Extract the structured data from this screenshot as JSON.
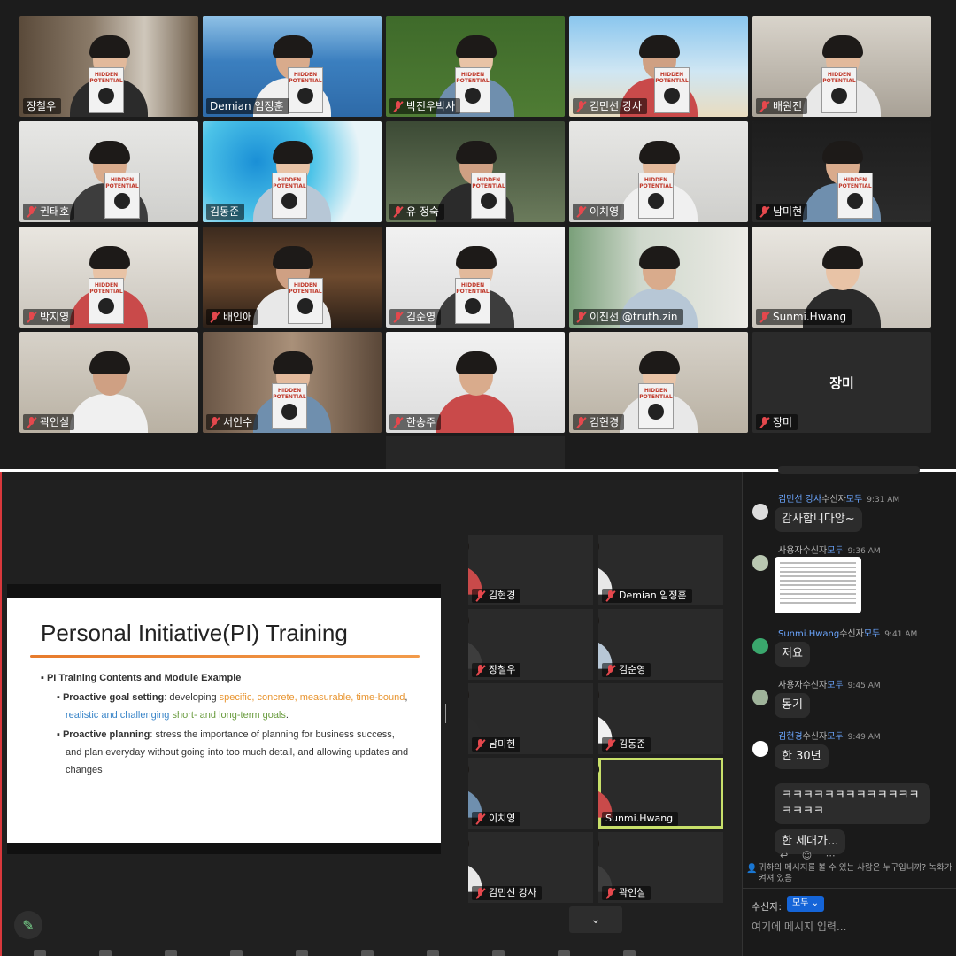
{
  "gallery": [
    {
      "name": "장철우",
      "muted": false,
      "bg": "library",
      "book": true
    },
    {
      "name": "Demian 임정훈",
      "muted": false,
      "bg": "ocean",
      "book": true,
      "active": true
    },
    {
      "name": "박진우박사",
      "muted": true,
      "bg": "green",
      "book": true
    },
    {
      "name": "김민선 강사",
      "muted": true,
      "bg": "beach",
      "book": true
    },
    {
      "name": "배원진",
      "muted": true,
      "bg": "hall",
      "book": true
    },
    {
      "name": "권태호",
      "muted": true,
      "bg": "office",
      "book": true
    },
    {
      "name": "김동준",
      "muted": false,
      "bg": "watercolor",
      "book": true
    },
    {
      "name": "유 정숙",
      "muted": true,
      "bg": "forest",
      "book": true
    },
    {
      "name": "이치영",
      "muted": true,
      "bg": "office",
      "book": true
    },
    {
      "name": "남미현",
      "muted": true,
      "bg": "dark",
      "book": true
    },
    {
      "name": "박지영",
      "muted": true,
      "bg": "room",
      "book": true
    },
    {
      "name": "배인애",
      "muted": true,
      "bg": "library2",
      "book": true
    },
    {
      "name": "김순영",
      "muted": true,
      "bg": "white",
      "book": true
    },
    {
      "name": "이진선 @truth.zin",
      "muted": true,
      "bg": "plant",
      "book": false
    },
    {
      "name": "Sunmi.Hwang",
      "muted": true,
      "bg": "room",
      "book": false
    },
    {
      "name": "곽인실",
      "muted": true,
      "bg": "blur",
      "book": false
    },
    {
      "name": "서인수",
      "muted": true,
      "bg": "shelf",
      "book": true
    },
    {
      "name": "한송주",
      "muted": true,
      "bg": "white",
      "book": false
    },
    {
      "name": "김현경",
      "muted": true,
      "bg": "blur",
      "book": true
    },
    {
      "name": "장미",
      "muted": true,
      "bg": "none",
      "book": false,
      "avatar_text": "장미"
    }
  ],
  "book_title": "HIDDEN POTENTIAL",
  "slide": {
    "title": "Personal Initiative(PI) Training",
    "heading": "PI Training Contents and Module Example",
    "item1_label": "Proactive goal setting",
    "item1_text": ": developing ",
    "item1_orange": "specific, concrete, measurable, time-bound",
    "item1_comma": ", ",
    "item1_blue": "realistic and challenging",
    "item1_space": " ",
    "item1_green": "short- and long-term goals",
    "item1_end": ".",
    "item2_label": "Proactive planning",
    "item2_text": ": stress the importance of planning for business success, and plan everyday without going into too much detail, and allowing updates and changes"
  },
  "side_tiles": [
    {
      "name": "김현경",
      "bg": "blur"
    },
    {
      "name": "Demian 임정훈",
      "bg": "ocean"
    },
    {
      "name": "장철우",
      "bg": "library"
    },
    {
      "name": "김순영",
      "bg": "white"
    },
    {
      "name": "남미현",
      "bg": "dark"
    },
    {
      "name": "김동준",
      "bg": "watercolor"
    },
    {
      "name": "이치영",
      "bg": "office"
    },
    {
      "name": "Sunmi.Hwang",
      "bg": "room",
      "active": true
    },
    {
      "name": "김민선 강사",
      "bg": "beach"
    },
    {
      "name": "곽인실",
      "bg": "blur"
    }
  ],
  "chat": {
    "recipient_word": "수신자",
    "everyone": "모두",
    "messages": [
      {
        "sender": "김민선 강사",
        "time": "9:31 AM",
        "text": "감사합니다앙~"
      },
      {
        "sender": "사용자",
        "time": "9:36 AM",
        "image": true
      },
      {
        "sender": "Sunmi.Hwang",
        "time": "9:41 AM",
        "text": "저요"
      },
      {
        "sender": "사용자",
        "time": "9:45 AM",
        "text": "동기"
      },
      {
        "sender": "김현경",
        "time": "9:49 AM",
        "text": "한 30년"
      },
      {
        "text": "ㅋㅋㅋㅋㅋㅋㅋㅋㅋㅋㅋㅋㅋㅋㅋㅋㅋ"
      },
      {
        "text": "한 세대가..."
      }
    ],
    "actions": "↩ ☺ ⋯",
    "privacy_note": "귀하의 메시지를 볼 수 있는 사람은 누구입니까? 녹화가 켜져 있음",
    "recipient_label": "수신자:",
    "recipient_value": "모두 ⌄",
    "input_placeholder": "여기에 메시지 입력..."
  },
  "colors": {
    "active_outline": "#c8e06a",
    "mute": "#e5484d",
    "chat_link": "#6ba6ff",
    "recipient_button": "#1565d8"
  },
  "icons": {
    "pen": "pen-icon",
    "chevron": "chevron-down-icon",
    "mute": "mic-muted-icon"
  }
}
